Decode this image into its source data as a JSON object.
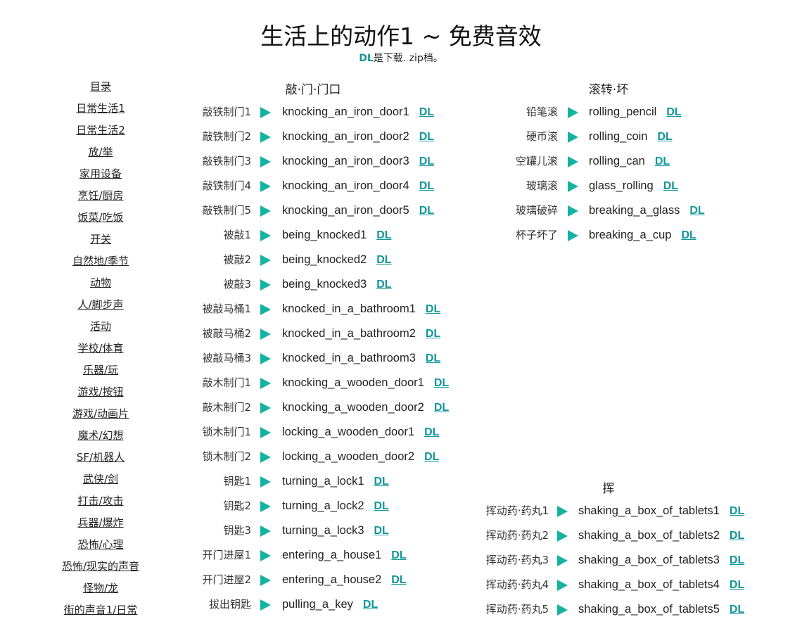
{
  "page": {
    "title": "生活上的动作1 ~ 免费音效",
    "subtitle_dl": "DL",
    "subtitle_rest": "是下载. zip档。"
  },
  "menu": [
    "目录",
    "日常生活1",
    "日常生活2",
    "放/举",
    "家用设备",
    "烹饪/厨房",
    "饭菜/吃饭",
    "开关",
    "自然地/季节",
    "动物",
    "人/脚步声",
    "活动",
    "学校/体育",
    "乐器/玩",
    "游戏/按钮",
    "游戏/动画片",
    "魔术/幻想",
    "SF/机器人",
    "武侠/剑",
    "打击/攻击",
    "兵器/爆炸",
    "恐怖/心理",
    "恐怖/现实的声音",
    "怪物/龙",
    "街的声音1/日常"
  ],
  "sections": {
    "door": {
      "title": "敲·门·门口",
      "rows": [
        {
          "cn": "敲铁制门1",
          "en": "knocking_an_iron_door1",
          "dl": "DL"
        },
        {
          "cn": "敲铁制门2",
          "en": "knocking_an_iron_door2",
          "dl": "DL"
        },
        {
          "cn": "敲铁制门3",
          "en": "knocking_an_iron_door3",
          "dl": "DL"
        },
        {
          "cn": "敲铁制门4",
          "en": "knocking_an_iron_door4",
          "dl": "DL"
        },
        {
          "cn": "敲铁制门5",
          "en": "knocking_an_iron_door5",
          "dl": "DL"
        },
        {
          "cn": "被敲1",
          "en": "being_knocked1",
          "dl": "DL"
        },
        {
          "cn": "被敲2",
          "en": "being_knocked2",
          "dl": "DL"
        },
        {
          "cn": "被敲3",
          "en": "being_knocked3",
          "dl": "DL"
        },
        {
          "cn": "被敲马桶1",
          "en": "knocked_in_a_bathroom1",
          "dl": "DL"
        },
        {
          "cn": "被敲马桶2",
          "en": "knocked_in_a_bathroom2",
          "dl": "DL"
        },
        {
          "cn": "被敲马桶3",
          "en": "knocked_in_a_bathroom3",
          "dl": "DL"
        },
        {
          "cn": "敲木制门1",
          "en": "knocking_a_wooden_door1",
          "dl": "DL"
        },
        {
          "cn": "敲木制门2",
          "en": "knocking_a_wooden_door2",
          "dl": "DL"
        },
        {
          "cn": "锁木制门1",
          "en": "locking_a_wooden_door1",
          "dl": "DL"
        },
        {
          "cn": "锁木制门2",
          "en": "locking_a_wooden_door2",
          "dl": "DL"
        },
        {
          "cn": "钥匙1",
          "en": "turning_a_lock1",
          "dl": "DL"
        },
        {
          "cn": "钥匙2",
          "en": "turning_a_lock2",
          "dl": "DL"
        },
        {
          "cn": "钥匙3",
          "en": "turning_a_lock3",
          "dl": "DL"
        },
        {
          "cn": "开门进屋1",
          "en": "entering_a_house1",
          "dl": "DL"
        },
        {
          "cn": "开门进屋2",
          "en": "entering_a_house2",
          "dl": "DL"
        },
        {
          "cn": "拔出钥匙",
          "en": "pulling_a_key",
          "dl": "DL"
        }
      ]
    },
    "roll": {
      "title": "滚转·坏",
      "rows": [
        {
          "cn": "铅笔滚",
          "en": "rolling_pencil",
          "dl": "DL"
        },
        {
          "cn": "硬币滚",
          "en": "rolling_coin",
          "dl": "DL"
        },
        {
          "cn": "空罐儿滚",
          "en": "rolling_can",
          "dl": "DL"
        },
        {
          "cn": "玻璃滚",
          "en": "glass_rolling",
          "dl": "DL"
        },
        {
          "cn": "玻璃破碎",
          "en": "breaking_a_glass",
          "dl": "DL"
        },
        {
          "cn": "杯子坏了",
          "en": "breaking_a_cup",
          "dl": "DL"
        }
      ]
    },
    "shake": {
      "title": "挥",
      "rows": [
        {
          "cn": "挥动药·药丸1",
          "en": "shaking_a_box_of_tablets1",
          "dl": "DL"
        },
        {
          "cn": "挥动药·药丸2",
          "en": "shaking_a_box_of_tablets2",
          "dl": "DL"
        },
        {
          "cn": "挥动药·药丸3",
          "en": "shaking_a_box_of_tablets3",
          "dl": "DL"
        },
        {
          "cn": "挥动药·药丸4",
          "en": "shaking_a_box_of_tablets4",
          "dl": "DL"
        },
        {
          "cn": "挥动药·药丸5",
          "en": "shaking_a_box_of_tablets5",
          "dl": "DL"
        }
      ]
    }
  },
  "colors": {
    "play": "#14b2a1",
    "dl": "#11969a"
  }
}
